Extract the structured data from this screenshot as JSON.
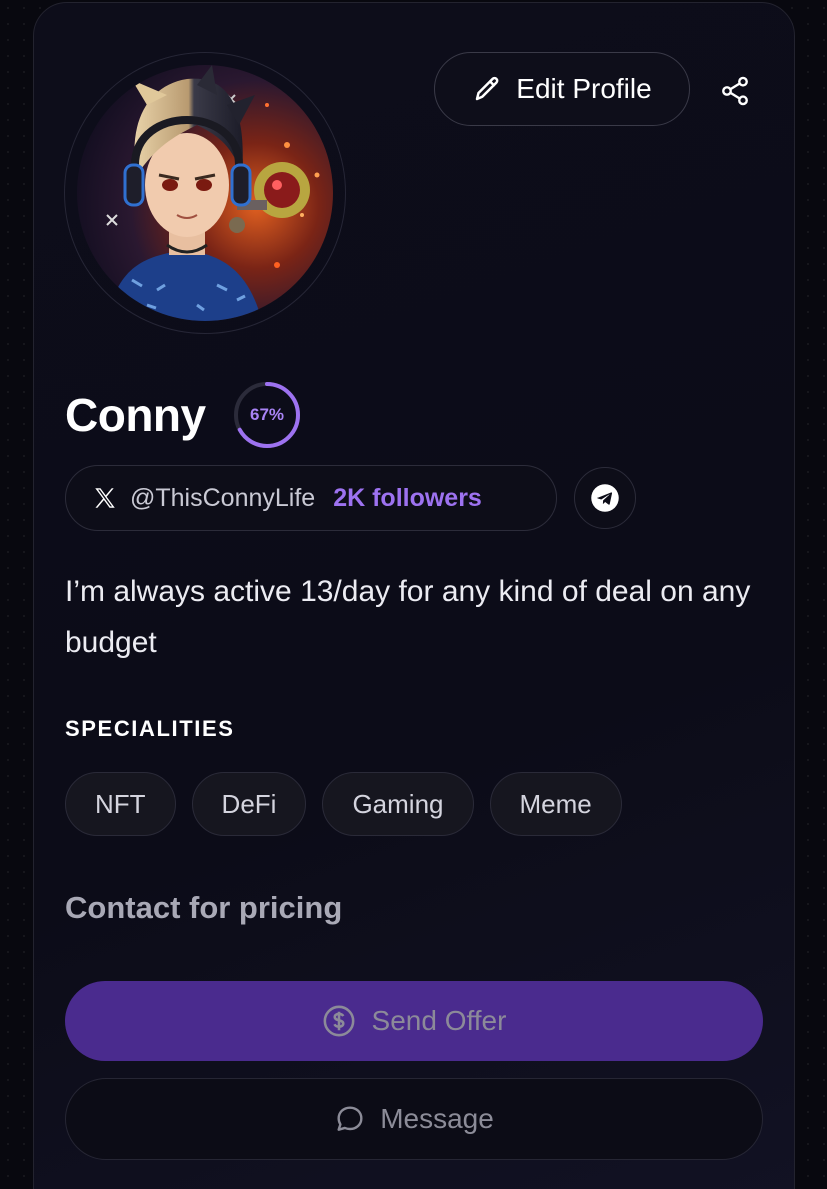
{
  "profile": {
    "edit_label": "Edit Profile",
    "name": "Conny",
    "completion_text": "67%",
    "completion": 0.67,
    "handle": "@ThisConnyLife",
    "followers": "2K followers",
    "bio": "I’m always active 13/day for any kind of deal on any budget",
    "specialities_title": "SPECIALITIES",
    "specialities": [
      "NFT",
      "DeFi",
      "Gaming",
      "Meme"
    ],
    "pricing": "Contact for pricing"
  },
  "actions": {
    "send_offer": "Send Offer",
    "message": "Message"
  },
  "icons": {
    "edit": "pencil-icon",
    "share": "share-icon",
    "x": "x-logo-icon",
    "telegram": "telegram-icon",
    "dollar": "dollar-circle-icon",
    "chat": "chat-bubble-icon"
  },
  "colors": {
    "accent": "#9d72f0",
    "button_primary": "#4a2b8e",
    "background": "#0c0c18"
  }
}
